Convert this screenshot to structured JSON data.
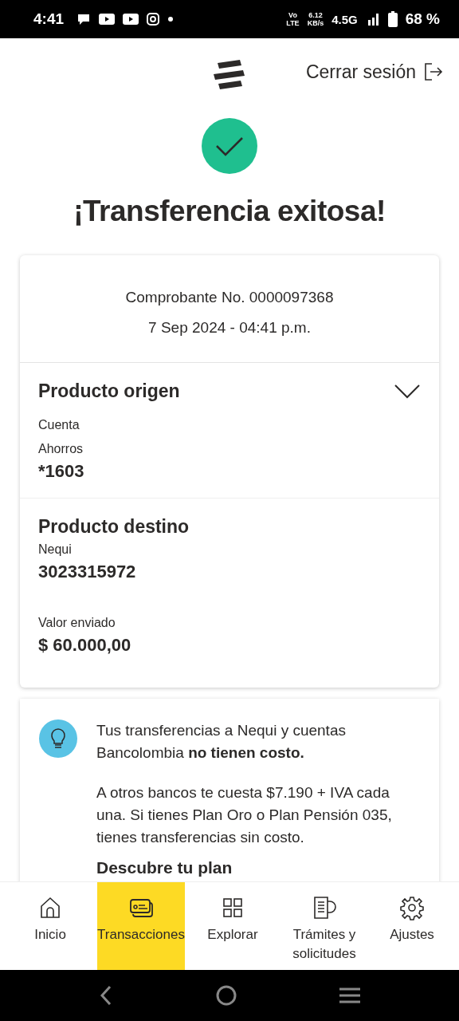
{
  "status_bar": {
    "time": "4:41",
    "volte": [
      "Vo",
      "LTE"
    ],
    "speed": [
      "6.12",
      "KB/s"
    ],
    "network": "4.5G",
    "battery": "68 %"
  },
  "header": {
    "logout": "Cerrar sesión"
  },
  "title": "¡Transferencia exitosa!",
  "receipt": {
    "number": "Comprobante No. 0000097368",
    "date": "7 Sep 2024 - 04:41 p.m.",
    "sections": [
      {
        "heading": "Producto origen",
        "kind": "collapsible",
        "expanded": false,
        "fields": [
          {
            "labels": [
              "Cuenta",
              "Ahorros"
            ],
            "value": "*1603"
          }
        ]
      },
      {
        "heading": "Producto destino",
        "kind": "static",
        "fields": [
          {
            "labels": [
              "Nequi"
            ],
            "value": "3023315972"
          },
          {
            "labels": [
              "Valor enviado"
            ],
            "value": "$ 60.000,00"
          }
        ]
      }
    ]
  },
  "info": {
    "paragraphs": [
      "Tus transferencias a Nequi y cuentas Bancolombia **no tienen costo.**",
      "A otros bancos te cuesta $7.190 + IVA cada una. Si tienes Plan Oro o Plan Pensión 035, tienes transferencias sin costo."
    ],
    "link": "Descubre tu plan"
  },
  "nav": [
    {
      "label": "Inicio",
      "selected": false
    },
    {
      "label": "Transacciones",
      "selected": true
    },
    {
      "label": "Explorar",
      "selected": false
    },
    {
      "label": "Trámites y solicitudes",
      "selected": false
    },
    {
      "label": "Ajustes",
      "selected": false
    }
  ]
}
